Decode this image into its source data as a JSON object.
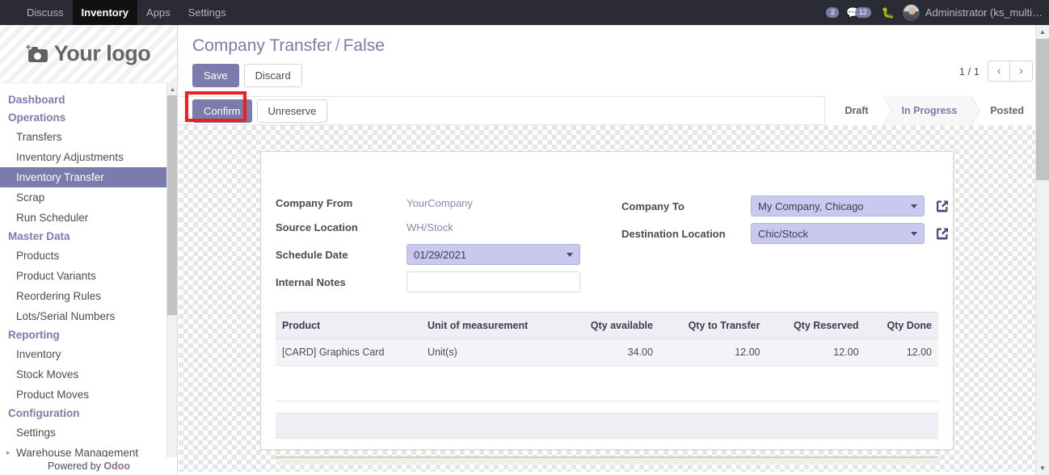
{
  "navbar": {
    "items": [
      {
        "label": "Discuss",
        "active": false
      },
      {
        "label": "Inventory",
        "active": true
      },
      {
        "label": "Apps",
        "active": false
      },
      {
        "label": "Settings",
        "active": false
      }
    ],
    "activity_icon": "clock-icon",
    "activity_count": "2",
    "messages_icon": "chat-bubble-icon",
    "messages_count": "12",
    "debug_icon": "bug-icon",
    "avatar_icon": "user-avatar",
    "user_name": "Administrator (ks_multi…"
  },
  "sidebar": {
    "logo_icon": "camera-icon",
    "logo_text": "Your logo",
    "groups": [
      {
        "header": "Dashboard",
        "items": []
      },
      {
        "header": "Operations",
        "items": [
          {
            "label": "Transfers",
            "active": false
          },
          {
            "label": "Inventory Adjustments",
            "active": false
          },
          {
            "label": "Inventory Transfer",
            "active": true
          },
          {
            "label": "Scrap",
            "active": false
          },
          {
            "label": "Run Scheduler",
            "active": false
          }
        ]
      },
      {
        "header": "Master Data",
        "items": [
          {
            "label": "Products",
            "active": false
          },
          {
            "label": "Product Variants",
            "active": false
          },
          {
            "label": "Reordering Rules",
            "active": false
          },
          {
            "label": "Lots/Serial Numbers",
            "active": false
          }
        ]
      },
      {
        "header": "Reporting",
        "items": [
          {
            "label": "Inventory",
            "active": false
          },
          {
            "label": "Stock Moves",
            "active": false
          },
          {
            "label": "Product Moves",
            "active": false
          }
        ]
      },
      {
        "header": "Configuration",
        "items": [
          {
            "label": "Settings",
            "active": false
          },
          {
            "label": "Warehouse Management",
            "active": false,
            "caret": true
          }
        ]
      }
    ],
    "footer_prefix": "Powered by ",
    "footer_brand": "Odoo",
    "scroll_up_icon": "triangle-up-icon",
    "scroll_down_icon": "triangle-down-icon"
  },
  "breadcrumb": {
    "root": "Company Transfer",
    "separator": "/",
    "current": "False"
  },
  "toolbar": {
    "save_label": "Save",
    "discard_label": "Discard"
  },
  "pager": {
    "label": "1 / 1",
    "prev_icon": "chevron-left-icon",
    "prev_label": "‹",
    "next_icon": "chevron-right-icon",
    "next_label": "›"
  },
  "sheet_header": {
    "confirm_label": "Confirm",
    "unreserve_label": "Unreserve",
    "highlight_color": "#f41c1c",
    "statusbar": [
      {
        "label": "Draft",
        "active": false
      },
      {
        "label": "In Progress",
        "active": true
      },
      {
        "label": "Posted",
        "active": false
      }
    ]
  },
  "form": {
    "left": [
      {
        "label": "Company From",
        "value": "YourCompany",
        "type": "readonly"
      },
      {
        "label": "Source Location",
        "value": "WH/Stock",
        "type": "readonly"
      },
      {
        "label": "Schedule Date",
        "value": "01/29/2021",
        "type": "select"
      },
      {
        "label": "Internal Notes",
        "value": "",
        "type": "input"
      }
    ],
    "right": [
      {
        "label": "Company To",
        "value": "My Company, Chicago",
        "type": "select",
        "link_icon": "external-link-icon"
      },
      {
        "label": "Destination Location",
        "value": "Chic/Stock",
        "type": "select",
        "link_icon": "external-link-icon"
      }
    ]
  },
  "lines_table": {
    "columns": [
      "Product",
      "Unit of measurement",
      "Qty available",
      "Qty to Transfer",
      "Qty Reserved",
      "Qty Done"
    ],
    "rows": [
      [
        "[CARD] Graphics Card",
        "Unit(s)",
        "34.00",
        "12.00",
        "12.00",
        "12.00"
      ]
    ]
  },
  "main_scroll": {
    "up_icon": "triangle-up-icon",
    "down_icon": "triangle-down-icon"
  },
  "colors": {
    "accent": "#7c7bad",
    "navbar_bg": "#2b2b33",
    "field_bg": "#c9c9f0",
    "highlight": "#f41c1c"
  }
}
